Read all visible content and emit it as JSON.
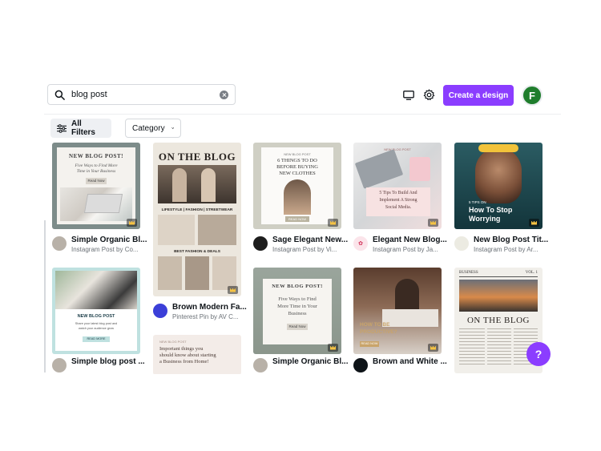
{
  "search": {
    "value": "blog post"
  },
  "header": {
    "create_label": "Create a design",
    "avatar_initial": "F"
  },
  "filters": {
    "all_filters_label": "All Filters",
    "category_label": "Category"
  },
  "colors": {
    "accent": "#8b3dff",
    "avatar_bg": "#1f7d2c"
  },
  "help": {
    "label": "?"
  },
  "templates": [
    {
      "title": "Simple Organic Bl...",
      "subtitle": "Instagram Post by Co...",
      "thumb": {
        "heading": "NEW BLOG POST!",
        "line1": "Five Ways to Find More",
        "line2": "Time in Your Business",
        "button": "Read Now"
      }
    },
    {
      "title": "Brown Modern Fa...",
      "subtitle": "Pinterest Pin by AV C...",
      "thumb": {
        "heading": "ON THE BLOG",
        "line1": "LIFESTYLE | FASHION | STREETWEAR",
        "line2": "BEST FASHION & DEALS"
      }
    },
    {
      "title": "Sage Elegant New...",
      "subtitle": "Instagram Post by Vi...",
      "thumb": {
        "kicker": "NEW BLOG POST",
        "line1": "6 THINGS TO DO",
        "line2": "BEFORE BUYING",
        "line3": "NEW CLOTHES",
        "button": "READ NOW"
      }
    },
    {
      "title": "Elegant New Blog...",
      "subtitle": "Instagram Post by Ja...",
      "thumb": {
        "kicker": "NEW BLOG POST",
        "line1": "5 Tips To Build And",
        "line2": "Implement A Strong",
        "line3": "Social Media."
      }
    },
    {
      "title": "New Blog Post Tit...",
      "subtitle": "Instagram Post by Ar...",
      "thumb": {
        "kicker": "5 TIPS ON",
        "line1": "How To Stop",
        "line2": "Worrying"
      }
    },
    {
      "title": "Simple blog post ...",
      "subtitle": "",
      "thumb": {
        "heading": "NEW BLOG POST",
        "line1": "Share your latest blog post and",
        "line2": "watch your audience grow",
        "button": "READ MORE"
      }
    },
    {
      "title": "",
      "subtitle": "",
      "thumb": {
        "kicker": "NEW BLOG POST",
        "line1": "Important things you",
        "line2": "should know about starting",
        "line3": "a Business from Home!"
      }
    },
    {
      "title": "Simple Organic Bl...",
      "subtitle": "",
      "thumb": {
        "heading": "NEW BLOG POST!",
        "line1": "Five Ways to Find",
        "line2": "More Time in Your",
        "line3": "Business",
        "button": "Read Now"
      }
    },
    {
      "title": "Brown and White ...",
      "subtitle": "",
      "thumb": {
        "line1": "HOW TO BE",
        "line2": "PRODUCTIVE?",
        "button": "READ NOW"
      }
    },
    {
      "title": "",
      "subtitle": "",
      "thumb": {
        "kicker": "BUSINESS",
        "kicker2": "VOL. 1",
        "heading": "ON THE BLOG"
      }
    }
  ]
}
